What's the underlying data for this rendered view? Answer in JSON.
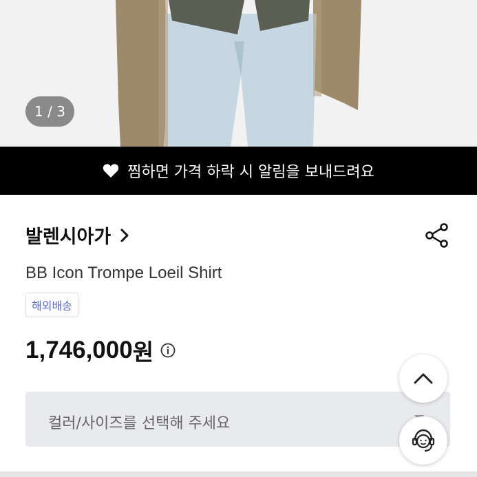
{
  "gallery": {
    "pager_text": "1 / 3"
  },
  "banner": {
    "text": "찜하면 가격 하락 시 알림을 보내드려요"
  },
  "product": {
    "brand": "발렌시아가",
    "name": "BB Icon Trompe Loeil Shirt",
    "tag": "해외배송",
    "price": "1,746,000",
    "price_unit": "원"
  },
  "option": {
    "placeholder": "컬러/사이즈를 선택해 주세요"
  },
  "icons": {
    "banner": "heart-icon",
    "brand": "chevron-right-icon",
    "share": "share-icon",
    "price_info": "info-icon",
    "option": "caret-down-icon",
    "scroll_top": "chevron-up-icon",
    "support": "customer-service-icon"
  },
  "colors": {
    "banner_bg": "#000000",
    "tag_text": "#5b6ad0",
    "option_bg": "#e9eaee"
  }
}
